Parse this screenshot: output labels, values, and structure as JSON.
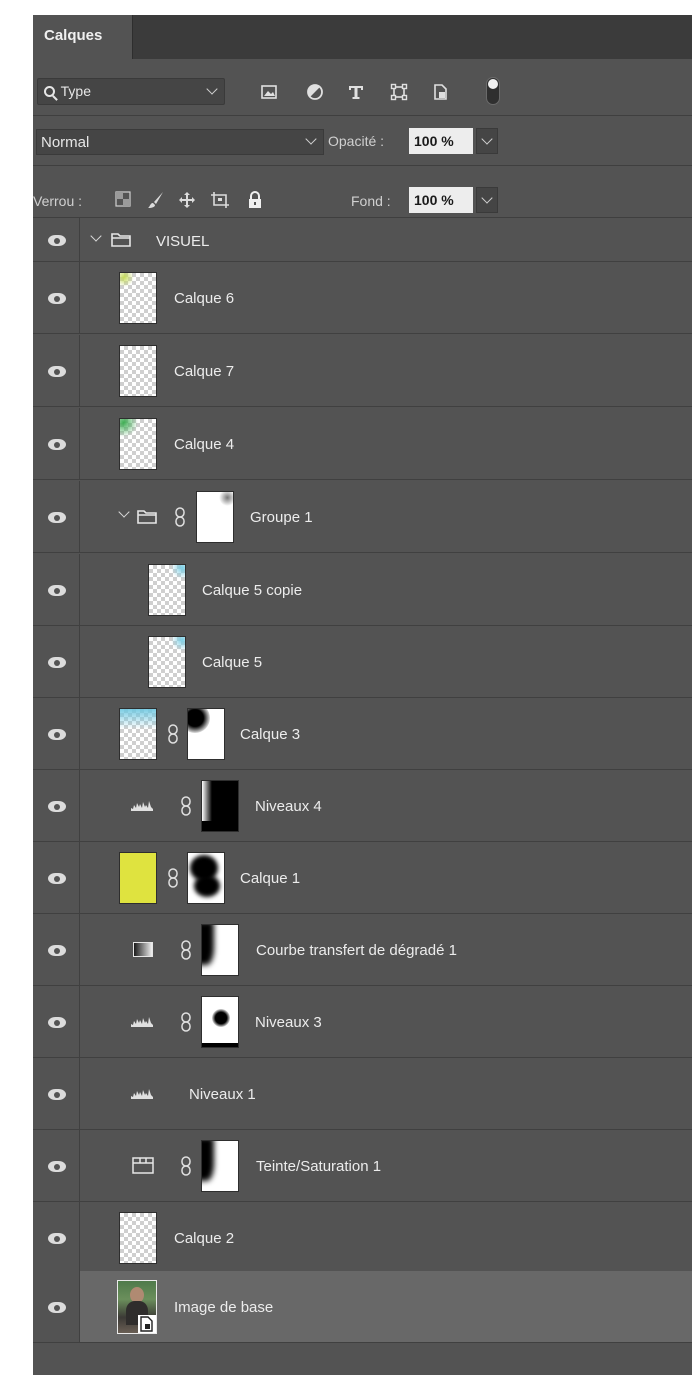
{
  "panel": {
    "tab_label": "Calques",
    "filter": {
      "kind": "Type",
      "icons": [
        "image-filter-icon",
        "adjustment-filter-icon",
        "type-filter-icon",
        "shape-filter-icon",
        "smart-object-filter-icon",
        "filter-toggle-icon"
      ]
    },
    "blend_mode": "Normal",
    "opacity_label": "Opacité :",
    "opacity_value": "100 %",
    "lock_label": "Verrou :",
    "fill_label": "Fond :",
    "fill_value": "100 %"
  },
  "layers": [
    {
      "name": "VISUEL",
      "type": "group"
    },
    {
      "name": "Calque 6",
      "type": "pixel"
    },
    {
      "name": "Calque 7",
      "type": "pixel"
    },
    {
      "name": "Calque 4",
      "type": "pixel"
    },
    {
      "name": "Groupe 1",
      "type": "group-mask"
    },
    {
      "name": "Calque 5 copie",
      "type": "pixel"
    },
    {
      "name": "Calque 5",
      "type": "pixel"
    },
    {
      "name": "Calque 3",
      "type": "pixel-mask"
    },
    {
      "name": "Niveaux 4",
      "type": "levels-mask"
    },
    {
      "name": "Calque 1",
      "type": "fill-mask",
      "fill_color": "#dfe33f"
    },
    {
      "name": "Courbe transfert de dégradé 1",
      "type": "gradient-map-mask"
    },
    {
      "name": "Niveaux 3",
      "type": "levels-mask"
    },
    {
      "name": "Niveaux 1",
      "type": "levels"
    },
    {
      "name": "Teinte/Saturation 1",
      "type": "hue-sat-mask"
    },
    {
      "name": "Calque 2",
      "type": "pixel"
    },
    {
      "name": "Image de base",
      "type": "smart-object",
      "selected": true
    }
  ]
}
